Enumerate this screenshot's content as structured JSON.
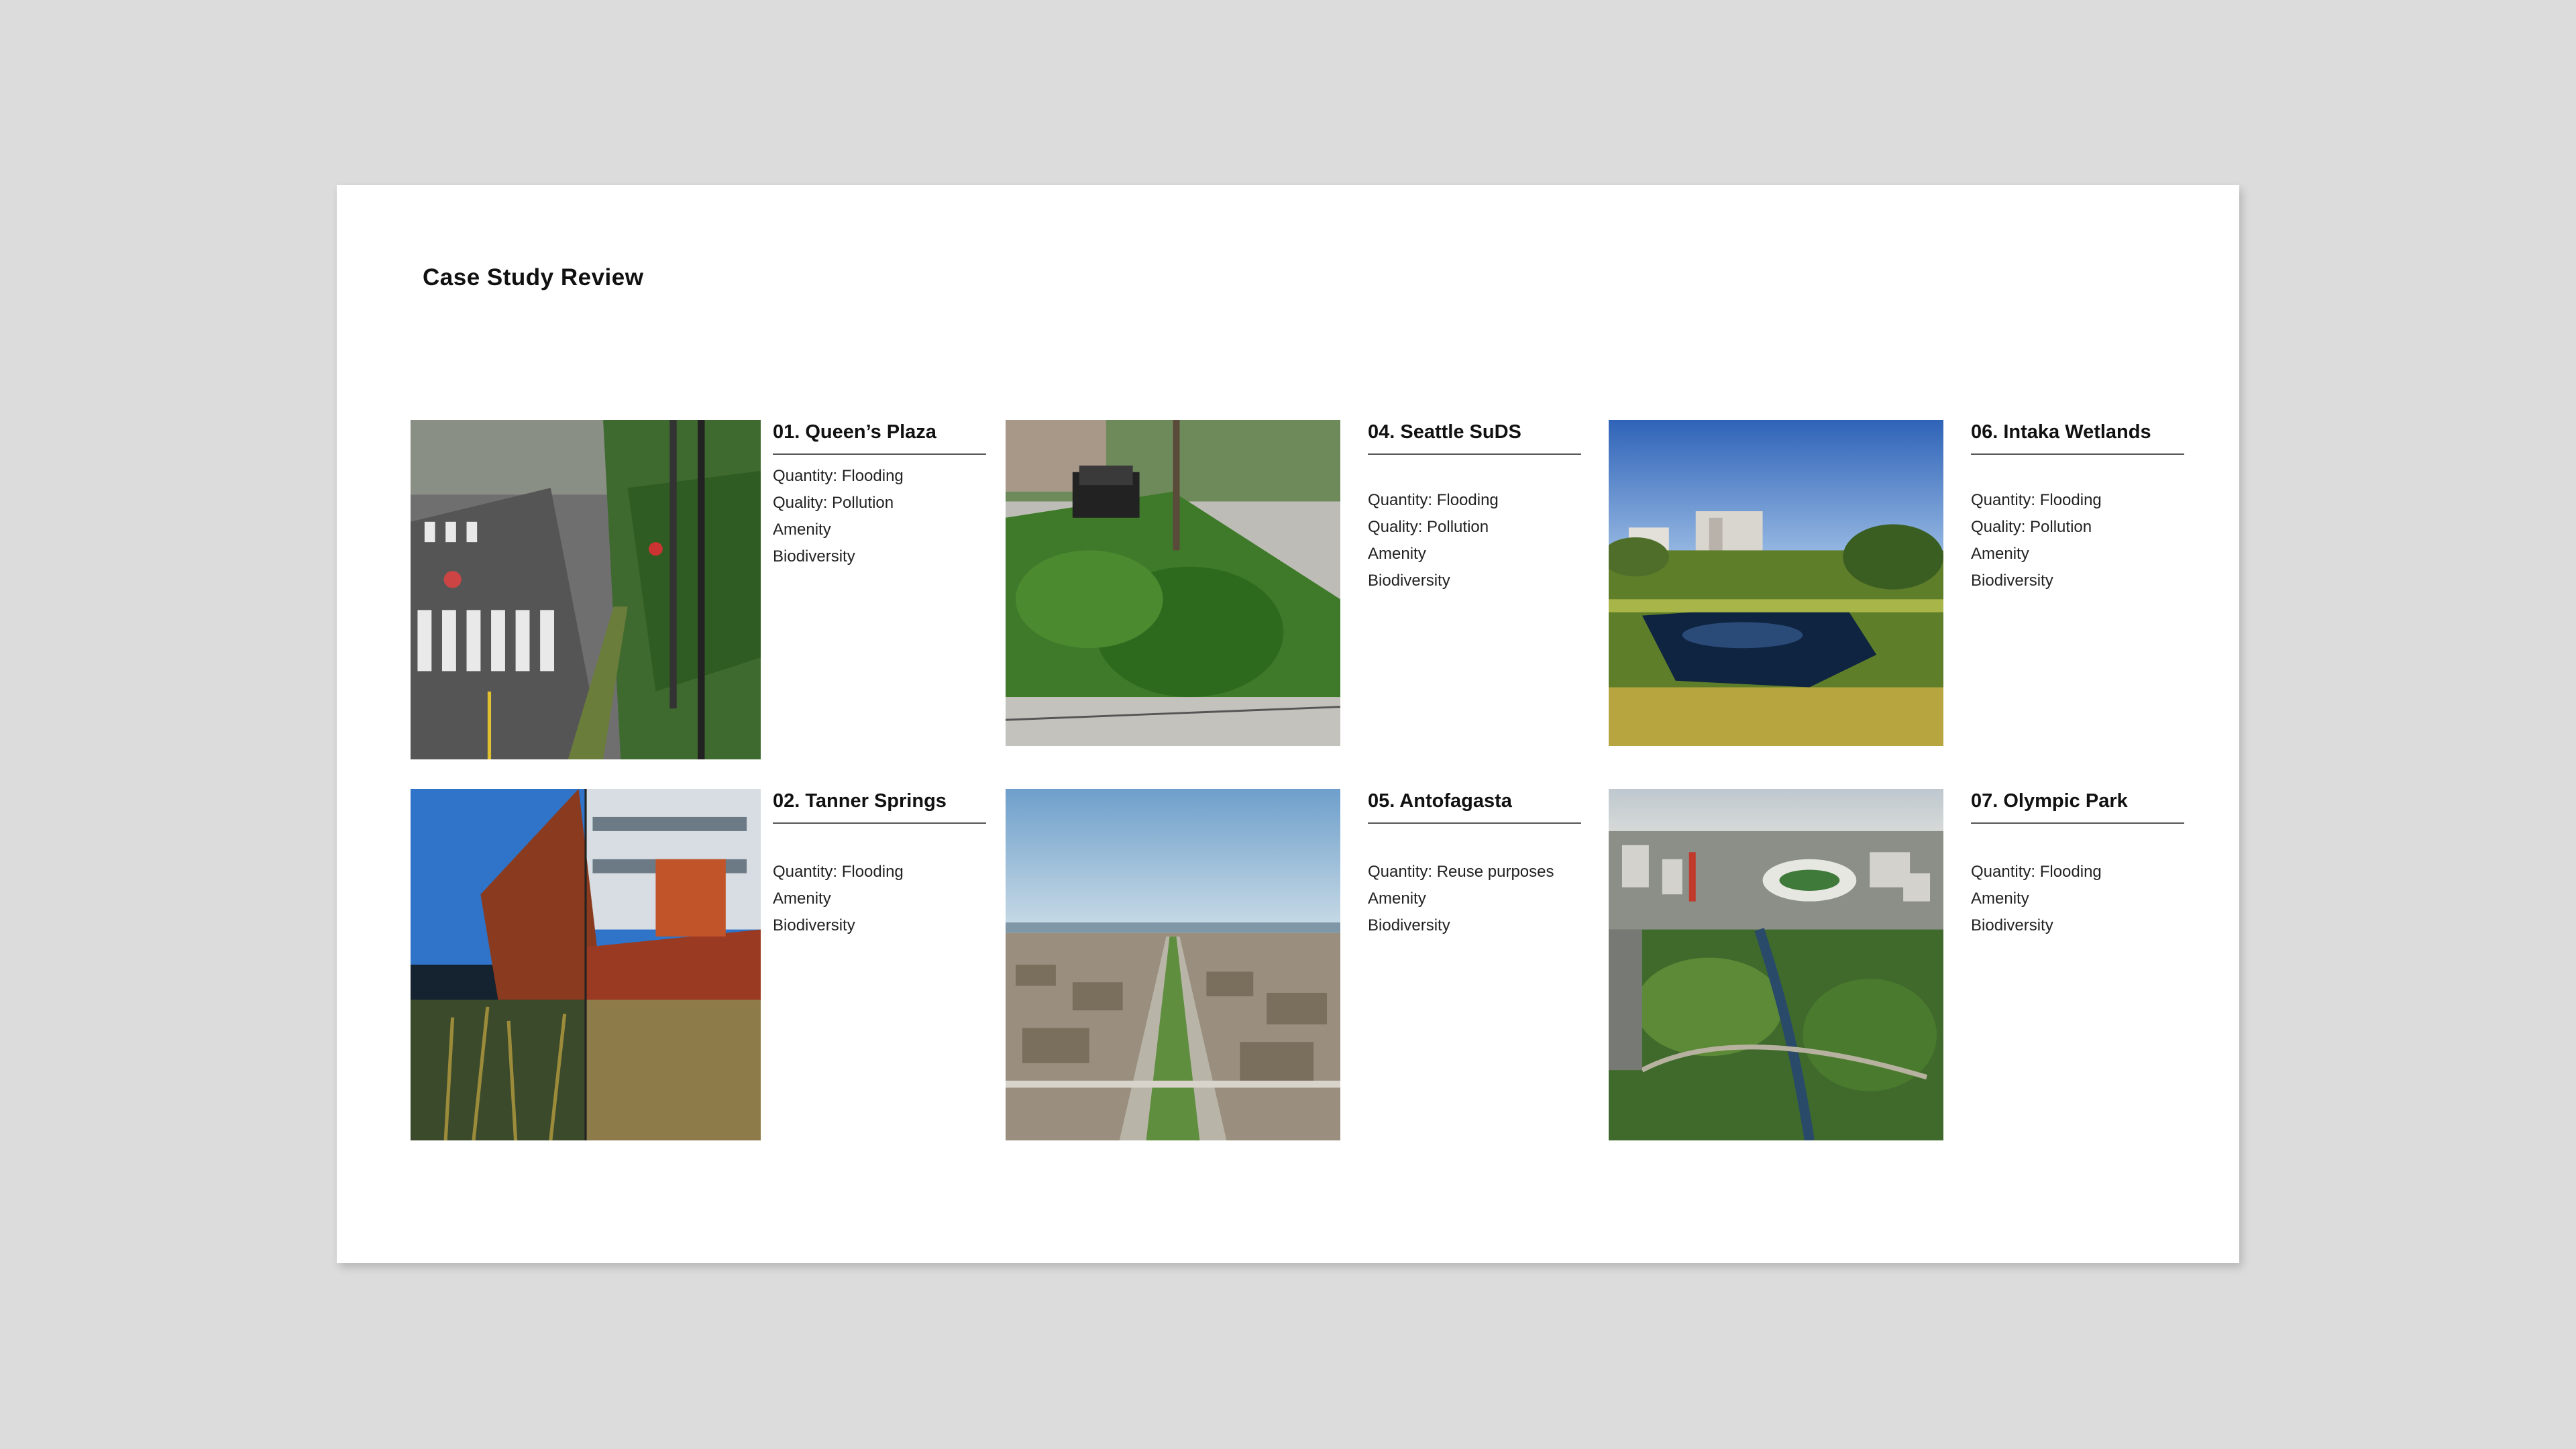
{
  "page": {
    "title": "Case Study Review"
  },
  "cases": [
    {
      "title": "01. Queen’s Plaza",
      "tags": [
        "Quantity: Flooding",
        "Quality: Pollution",
        "Amenity",
        "Biodiversity"
      ]
    },
    {
      "title": "02. Tanner Springs",
      "tags": [
        "Quantity: Flooding",
        "Amenity",
        "Biodiversity"
      ]
    },
    {
      "title": "04. Seattle SuDS",
      "tags": [
        "Quantity: Flooding",
        "Quality: Pollution",
        "Amenity",
        "Biodiversity"
      ]
    },
    {
      "title": "05. Antofagasta",
      "tags": [
        "Quantity: Reuse purposes",
        "Amenity",
        "Biodiversity"
      ]
    },
    {
      "title": "06. Intaka Wetlands",
      "tags": [
        "Quantity: Flooding",
        "Quality: Pollution",
        "Amenity",
        "Biodiversity"
      ]
    },
    {
      "title": "07. Olympic Park",
      "tags": [
        "Quantity: Flooding",
        "Amenity",
        "Biodiversity"
      ]
    }
  ]
}
